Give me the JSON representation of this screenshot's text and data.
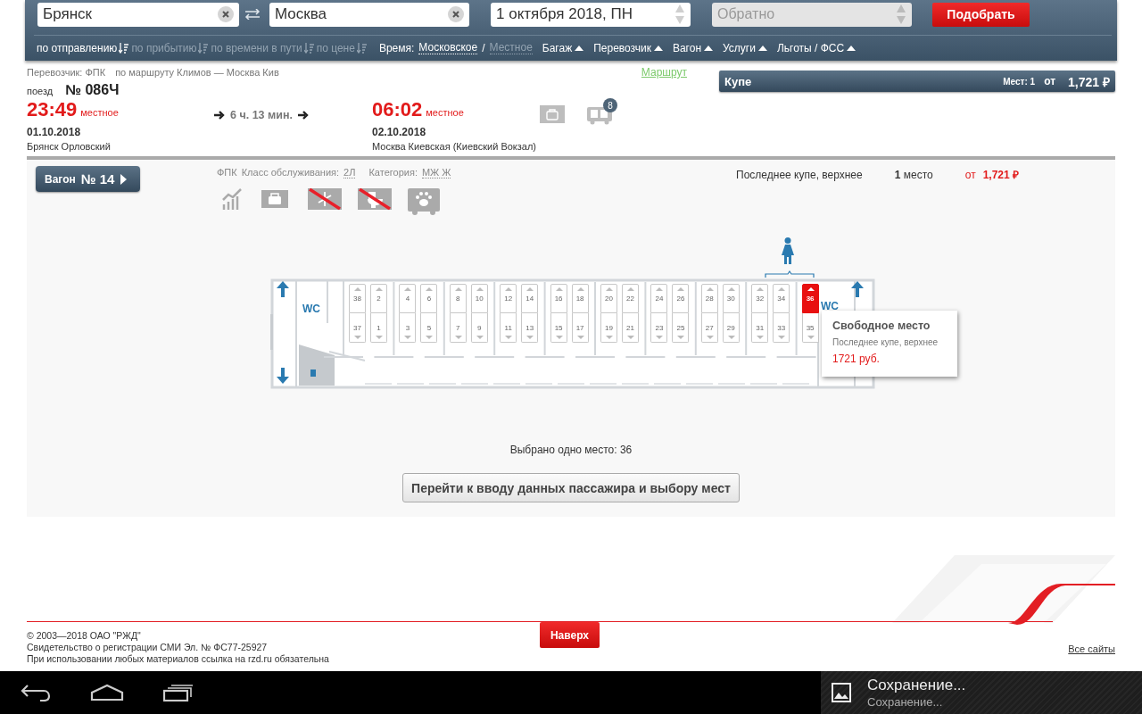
{
  "search": {
    "from": "Брянск",
    "to": "Москва",
    "date": "1 октября 2018, ПН",
    "return_placeholder": "Обратно",
    "submit": "Подобрать"
  },
  "sort": [
    {
      "label": "по отправлению",
      "selected": true
    },
    {
      "label": "по прибытию",
      "selected": false
    },
    {
      "label": "по времени в пути",
      "selected": false
    },
    {
      "label": "по цене",
      "selected": false
    }
  ],
  "time": {
    "label": "Время:",
    "separator": "/",
    "options": [
      {
        "label": "Московское",
        "selected": true
      },
      {
        "label": "Местное",
        "selected": false
      }
    ]
  },
  "filters": [
    "Багаж",
    "Перевозчик",
    "Вагон",
    "Услуги",
    "Льготы / ФСС"
  ],
  "train": {
    "carrier": "Перевозчик: ФПК",
    "route": "по маршруту Климов — Москва Кив",
    "route_link": "Маршрут",
    "train_label": "поезд",
    "number": "№ 086Ч",
    "departure": {
      "time": "23:49",
      "note": "местное",
      "date": "01.10.2018",
      "station": "Брянск Орловский"
    },
    "duration": "6 ч. 13 мин.",
    "arrival": {
      "time": "06:02",
      "note": "местное",
      "date": "02.10.2018",
      "station": "Москва Киевская (Киевский Вокзал)"
    },
    "cars_badge": "8"
  },
  "class_bar": {
    "name": "Купе",
    "seats": "Мест: 1",
    "from": "от",
    "price": "1,721 ₽"
  },
  "car": {
    "button_label": "Вагон",
    "number": "№ 14",
    "carrier": "ФПК",
    "service_label": "Класс обслуживания:",
    "service_value": "2Л",
    "category_label": "Категория:",
    "category_value": "МЖ Ж",
    "summary": "Последнее купе, верхнее",
    "count": "1",
    "count_unit": "место",
    "price_from": "от",
    "price": "1,721 ₽"
  },
  "amenities": [
    {
      "kind": "chart",
      "crossed": false
    },
    {
      "kind": "bag",
      "crossed": false
    },
    {
      "kind": "snowflake",
      "crossed": true
    },
    {
      "kind": "toilet",
      "crossed": true
    },
    {
      "kind": "paw",
      "crossed": false
    }
  ],
  "seat_map": {
    "wc_labels": [
      "WC",
      "WC"
    ],
    "columns": [
      {
        "upper": {
          "number": "38",
          "selected": false
        },
        "lower": {
          "number": "37",
          "selected": false
        }
      },
      {
        "upper": {
          "number": "2",
          "selected": false
        },
        "lower": {
          "number": "1",
          "selected": false
        }
      },
      {
        "upper": {
          "number": "4",
          "selected": false
        },
        "lower": {
          "number": "3",
          "selected": false
        }
      },
      {
        "upper": {
          "number": "6",
          "selected": false
        },
        "lower": {
          "number": "5",
          "selected": false
        }
      },
      {
        "upper": {
          "number": "8",
          "selected": false
        },
        "lower": {
          "number": "7",
          "selected": false
        }
      },
      {
        "upper": {
          "number": "10",
          "selected": false
        },
        "lower": {
          "number": "9",
          "selected": false
        }
      },
      {
        "upper": {
          "number": "12",
          "selected": false
        },
        "lower": {
          "number": "11",
          "selected": false
        }
      },
      {
        "upper": {
          "number": "14",
          "selected": false
        },
        "lower": {
          "number": "13",
          "selected": false
        }
      },
      {
        "upper": {
          "number": "16",
          "selected": false
        },
        "lower": {
          "number": "15",
          "selected": false
        }
      },
      {
        "upper": {
          "number": "18",
          "selected": false
        },
        "lower": {
          "number": "17",
          "selected": false
        }
      },
      {
        "upper": {
          "number": "20",
          "selected": false
        },
        "lower": {
          "number": "19",
          "selected": false
        }
      },
      {
        "upper": {
          "number": "22",
          "selected": false
        },
        "lower": {
          "number": "21",
          "selected": false
        }
      },
      {
        "upper": {
          "number": "24",
          "selected": false
        },
        "lower": {
          "number": "23",
          "selected": false
        }
      },
      {
        "upper": {
          "number": "26",
          "selected": false
        },
        "lower": {
          "number": "25",
          "selected": false
        }
      },
      {
        "upper": {
          "number": "28",
          "selected": false
        },
        "lower": {
          "number": "27",
          "selected": false
        }
      },
      {
        "upper": {
          "number": "30",
          "selected": false
        },
        "lower": {
          "number": "29",
          "selected": false
        }
      },
      {
        "upper": {
          "number": "32",
          "selected": false
        },
        "lower": {
          "number": "31",
          "selected": false
        }
      },
      {
        "upper": {
          "number": "34",
          "selected": false
        },
        "lower": {
          "number": "33",
          "selected": false
        }
      },
      {
        "upper": {
          "number": "36",
          "selected": true
        },
        "lower": {
          "number": "35",
          "selected": false
        }
      }
    ]
  },
  "tooltip": {
    "title": "Свободное место",
    "description": "Последнее купе, верхнее",
    "price": "1721 руб."
  },
  "selection_text": "Выбрано одно место: 36",
  "continue_button": "Перейти к вводу данных пассажира и выбору мест",
  "footer": {
    "lines": [
      "© 2003—2018  ОАО \"РЖД\"",
      "Свидетельство о регистрации СМИ Эл. № ФС77-25927",
      "При использовании любых материалов ссылка на rzd.ru обязательна"
    ],
    "top_button": "Наверх",
    "all_sites": "Все сайты"
  },
  "notification": {
    "title": "Сохранение...",
    "subtitle": "Сохранение..."
  }
}
